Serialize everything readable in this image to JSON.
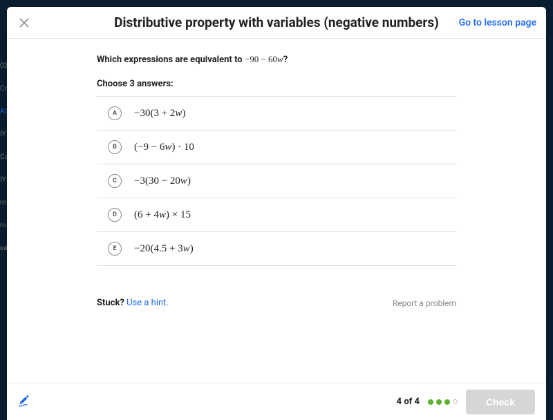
{
  "header": {
    "title": "Distributive property with variables (negative numbers)",
    "lesson_link": "Go to lesson page"
  },
  "question": {
    "prefix": "Which expressions are equivalent to ",
    "expression": "−90 − 60w",
    "suffix": "?",
    "choose_label": "Choose 3 answers:"
  },
  "answers": [
    {
      "letter": "A",
      "expr": "−30(3 + 2w)"
    },
    {
      "letter": "B",
      "expr": "(−9 − 6w) · 10"
    },
    {
      "letter": "C",
      "expr": "−3(30 − 20w)"
    },
    {
      "letter": "D",
      "expr": "(6 + 4w) × 15"
    },
    {
      "letter": "E",
      "expr": "−20(4.5 + 3w)"
    }
  ],
  "hints": {
    "stuck_label": "Stuck? ",
    "hint_link": "Use a hint.",
    "report_label": "Report a problem"
  },
  "footer": {
    "progress_text": "4 of 4",
    "dots": [
      "filled",
      "filled",
      "filled",
      "empty"
    ],
    "check_label": "Check"
  },
  "bg_sidebar": [
    "02",
    "Cou",
    "ASS",
    "IY",
    "Cou",
    "IY",
    "ro",
    "ro",
    "ea"
  ]
}
